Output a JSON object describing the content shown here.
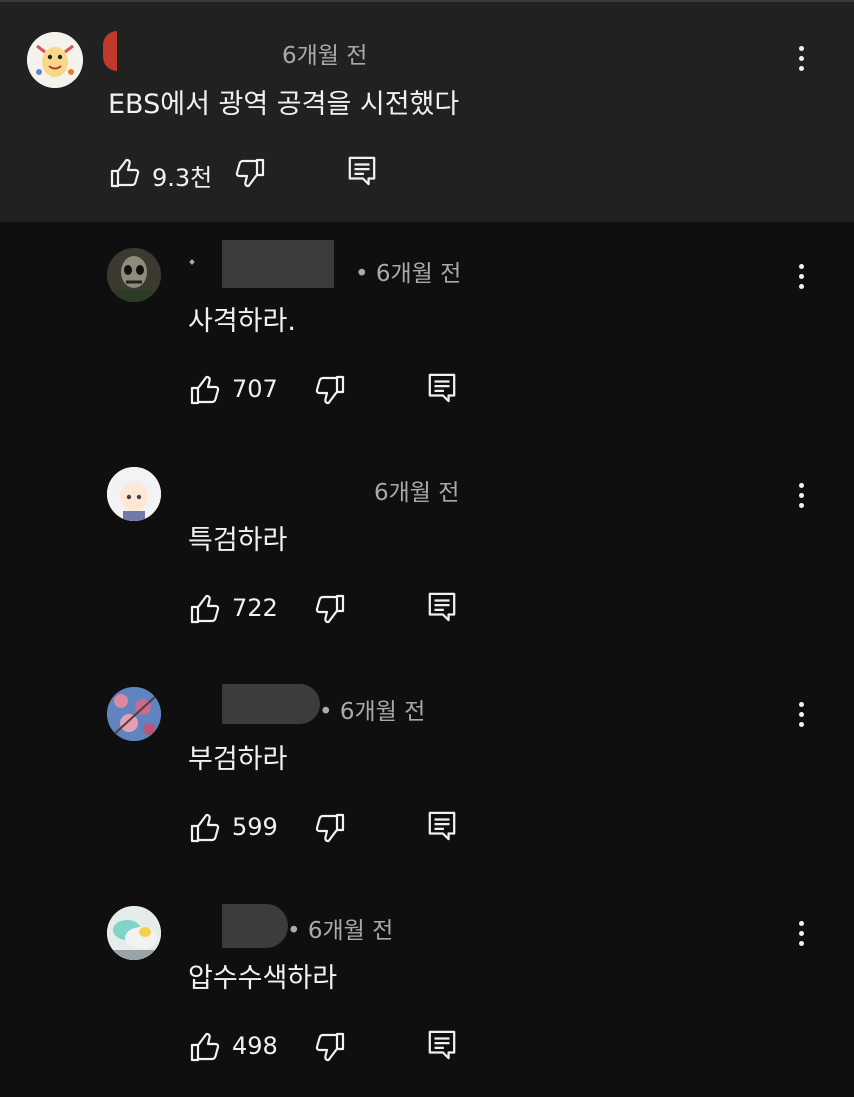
{
  "comment": {
    "time": "6개월 전",
    "text": "EBS에서 광역 공격을 시전했다",
    "likes": "9.3천"
  },
  "replies": [
    {
      "meta": "• 6개월 전",
      "text": "사격하라.",
      "likes": "707"
    },
    {
      "meta": "6개월 전",
      "text": "특검하라",
      "likes": "722"
    },
    {
      "meta": "• 6개월 전",
      "text": "부검하라",
      "likes": "599"
    },
    {
      "meta": "• 6개월 전",
      "text": "압수수색하라",
      "likes": "498"
    }
  ],
  "icons": {
    "like": "thumbs-up-icon",
    "dislike": "thumbs-down-icon",
    "reply": "reply-icon",
    "more": "more-vert-icon"
  },
  "colors": {
    "background": "#0f0f0f",
    "highlight_card": "#212121",
    "text_primary": "#f1f1f1",
    "text_secondary": "#aaaaaa"
  }
}
